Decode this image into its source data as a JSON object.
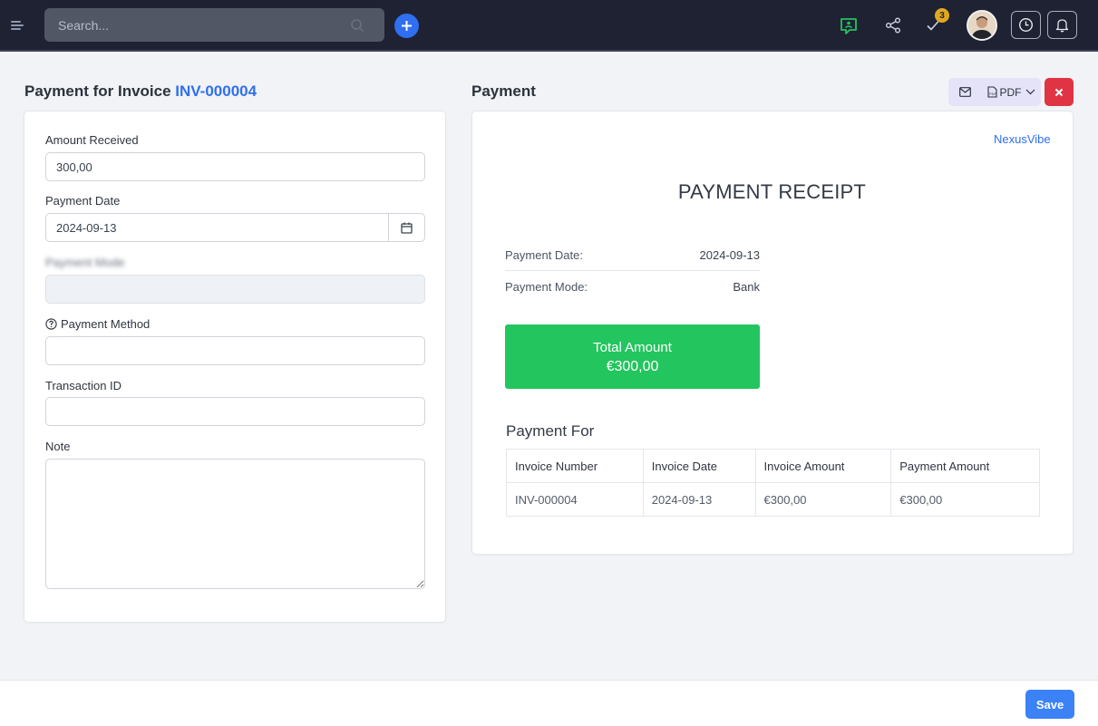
{
  "topbar": {
    "search_placeholder": "Search...",
    "notification_count": "3",
    "icons": [
      "menu-icon",
      "search-icon",
      "plus-icon",
      "chat-icon",
      "share-icon",
      "check-icon",
      "clock-icon",
      "bell-icon"
    ]
  },
  "left": {
    "title_prefix": "Payment for Invoice ",
    "invoice_number": "INV-000004",
    "fields": {
      "amount_label": "Amount Received",
      "amount_value": "300,00",
      "date_label": "Payment Date",
      "date_value": "2024-09-13",
      "mode_label": "Payment Mode",
      "mode_value": "",
      "method_label": "Payment Method",
      "method_value": "",
      "transaction_label": "Transaction ID",
      "transaction_value": "",
      "note_label": "Note",
      "note_value": ""
    }
  },
  "right": {
    "title": "Payment",
    "toolbar": {
      "pdf_label": "PDF"
    },
    "receipt": {
      "brand": "NexusVibe",
      "title": "PAYMENT RECEIPT",
      "rows": [
        {
          "label": "Payment Date:",
          "value": "2024-09-13"
        },
        {
          "label": "Payment Mode:",
          "value": "Bank"
        }
      ],
      "total_label": "Total Amount",
      "total_value": "€300,00",
      "payment_for_title": "Payment For",
      "table": {
        "headers": [
          "Invoice Number",
          "Invoice Date",
          "Invoice Amount",
          "Payment Amount"
        ],
        "rows": [
          [
            "INV-000004",
            "2024-09-13",
            "€300,00",
            "€300,00"
          ]
        ]
      }
    }
  },
  "footer": {
    "save_label": "Save"
  },
  "colors": {
    "accent": "#2f6ff0",
    "topbar": "#1f2233",
    "success": "#23c55e",
    "danger": "#e03444",
    "save": "#3b82f6"
  }
}
